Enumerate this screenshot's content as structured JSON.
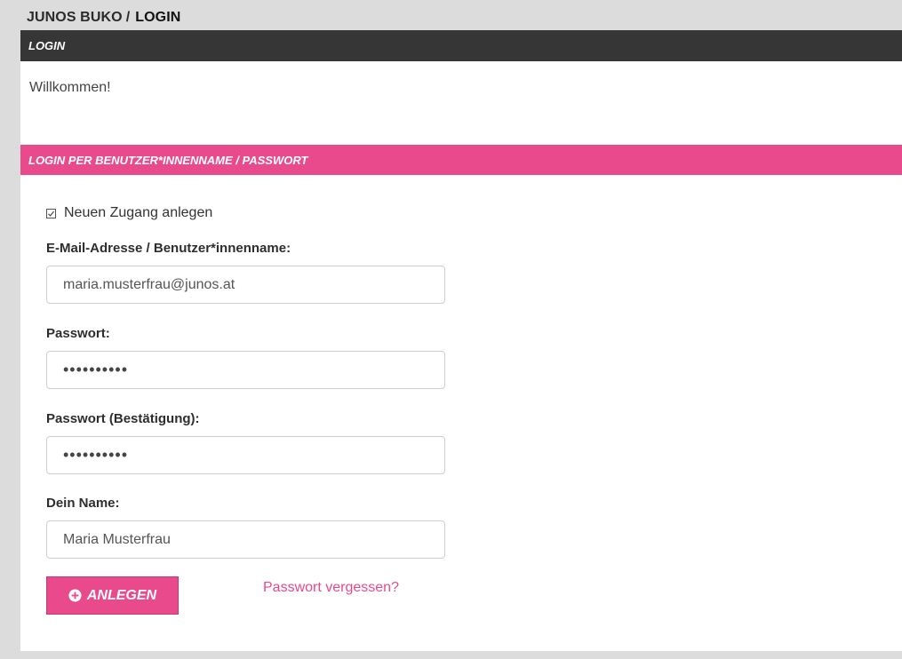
{
  "breadcrumb": {
    "parent": "JUNOS BUKO",
    "separator": "/",
    "current": "LOGIN"
  },
  "login_header": "LOGIN",
  "welcome_text": "Willkommen!",
  "section_header": "LOGIN PER BENUTZER*INNENNAME / PASSWORT",
  "new_account": {
    "label": "Neuen Zugang anlegen",
    "checked": true
  },
  "fields": {
    "email": {
      "label": "E-Mail-Adresse / Benutzer*innenname:",
      "value": "maria.musterfrau@junos.at"
    },
    "password": {
      "label": "Passwort:",
      "value": "••••••••••"
    },
    "password_confirm": {
      "label": "Passwort (Bestätigung):",
      "value": "••••••••••"
    },
    "name": {
      "label": "Dein Name:",
      "value": "Maria Musterfrau"
    }
  },
  "submit_button": {
    "label": "ANLEGEN",
    "icon": "plus-circle-icon"
  },
  "forgot_password_link": "Passwort vergessen?",
  "colors": {
    "accent_pink": "#e84a8c",
    "header_dark": "#363636",
    "background": "#dcdcdc"
  }
}
